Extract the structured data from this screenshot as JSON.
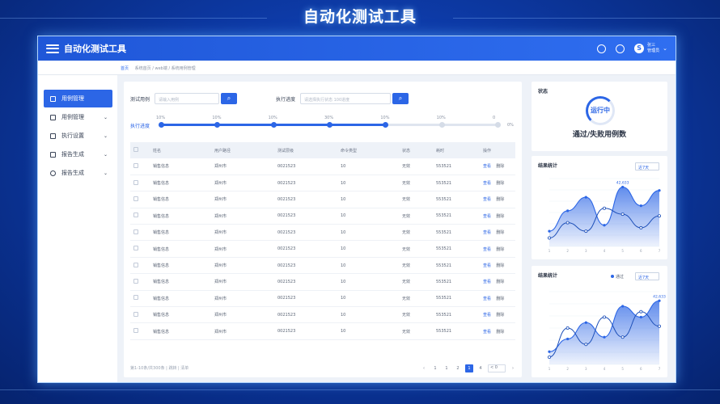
{
  "page_title": "自动化测试工具",
  "app": {
    "title": "自动化测试工具",
    "user_name": "张三",
    "user_role": "管理员"
  },
  "breadcrumb": {
    "home": "首页",
    "path": "系统首页 / web端 / 系统用例管理"
  },
  "sidebar": {
    "items": [
      {
        "label": "用例管理",
        "icon": "home-icon",
        "active": true
      },
      {
        "label": "用例管理",
        "icon": "document-icon",
        "active": false
      },
      {
        "label": "执行设置",
        "icon": "document-icon",
        "active": false
      },
      {
        "label": "报告生成",
        "icon": "printer-icon",
        "active": false
      },
      {
        "label": "报告生成",
        "icon": "clock-icon",
        "active": false
      }
    ]
  },
  "filters": {
    "case_label": "测试用例",
    "case_placeholder": "请输入用例",
    "progress_label": "执行进度",
    "progress_placeholder": "请选择执行状态 100进度"
  },
  "progress": {
    "label": "执行进度",
    "end_label": "0%",
    "fraction": 0.67,
    "steps": [
      "10%",
      "10%",
      "10%",
      "30%",
      "10%",
      "10%",
      "0"
    ]
  },
  "table": {
    "columns": [
      "",
      "姓名",
      "用户路径",
      "测试层级",
      "命令类型",
      "状态",
      "耗时",
      "操作"
    ],
    "rows": [
      [
        "",
        "销售信息",
        "郑州市",
        "0021523",
        "10",
        "无效",
        "553521",
        "查看",
        "删除"
      ],
      [
        "",
        "销售信息",
        "郑州市",
        "0021523",
        "10",
        "无效",
        "553521",
        "查看",
        "删除"
      ],
      [
        "",
        "销售信息",
        "郑州市",
        "0021523",
        "10",
        "无效",
        "553521",
        "查看",
        "删除"
      ],
      [
        "",
        "销售信息",
        "郑州市",
        "0021523",
        "10",
        "无效",
        "553521",
        "查看",
        "删除"
      ],
      [
        "",
        "销售信息",
        "郑州市",
        "0021523",
        "10",
        "无效",
        "553521",
        "查看",
        "删除"
      ],
      [
        "",
        "销售信息",
        "郑州市",
        "0021523",
        "10",
        "无效",
        "553521",
        "查看",
        "删除"
      ],
      [
        "",
        "销售信息",
        "郑州市",
        "0021523",
        "10",
        "无效",
        "553521",
        "查看",
        "删除"
      ],
      [
        "",
        "销售信息",
        "郑州市",
        "0021523",
        "10",
        "无效",
        "553521",
        "查看",
        "删除"
      ],
      [
        "",
        "销售信息",
        "郑州市",
        "0021523",
        "10",
        "无效",
        "553521",
        "查看",
        "删除"
      ],
      [
        "",
        "销售信息",
        "郑州市",
        "0021523",
        "10",
        "无效",
        "553521",
        "查看",
        "删除"
      ],
      [
        "",
        "销售信息",
        "郑州市",
        "0021523",
        "10",
        "无效",
        "553521",
        "查看",
        "删除"
      ]
    ]
  },
  "footer": {
    "summary": "第1-10条/共300条 | 跳转 | 清单"
  },
  "pagination": {
    "prev": "‹",
    "pages": [
      "1",
      "1",
      "2",
      "1",
      "4"
    ],
    "active_index": 3,
    "next": "›",
    "goto_placeholder": "< 0"
  },
  "status_card": {
    "title": "状态",
    "ring_text": "运行中",
    "caption": "通过/失败用例数"
  },
  "chart_card_1": {
    "title": "结果统计",
    "select": "近7天"
  },
  "chart_card_2": {
    "title": "结果统计",
    "legend": "通过",
    "select": "近7天"
  },
  "colors": {
    "accent": "#2c66e6",
    "topbar": "#1f57d8",
    "background": "#0d3aa6"
  },
  "chart_data": [
    {
      "type": "area",
      "title": "结果统计",
      "x": [
        "1",
        "2",
        "3",
        "4",
        "5",
        "6",
        "7"
      ],
      "series": [
        {
          "values": [
            10,
            28,
            18,
            45,
            38,
            22,
            36
          ]
        },
        {
          "values": [
            18,
            42,
            58,
            25,
            70,
            48,
            66
          ]
        }
      ],
      "annotation": "42,633",
      "ylim": [
        0,
        80
      ]
    },
    {
      "type": "area",
      "title": "结果统计",
      "x": [
        "1",
        "2",
        "3",
        "4",
        "5",
        "6",
        "7"
      ],
      "series": [
        {
          "name": "通过",
          "values": [
            8,
            40,
            22,
            52,
            30,
            58,
            42
          ]
        },
        {
          "values": [
            14,
            28,
            46,
            30,
            64,
            52,
            70
          ]
        }
      ],
      "annotation": "42,633",
      "ylim": [
        0,
        80
      ]
    }
  ]
}
